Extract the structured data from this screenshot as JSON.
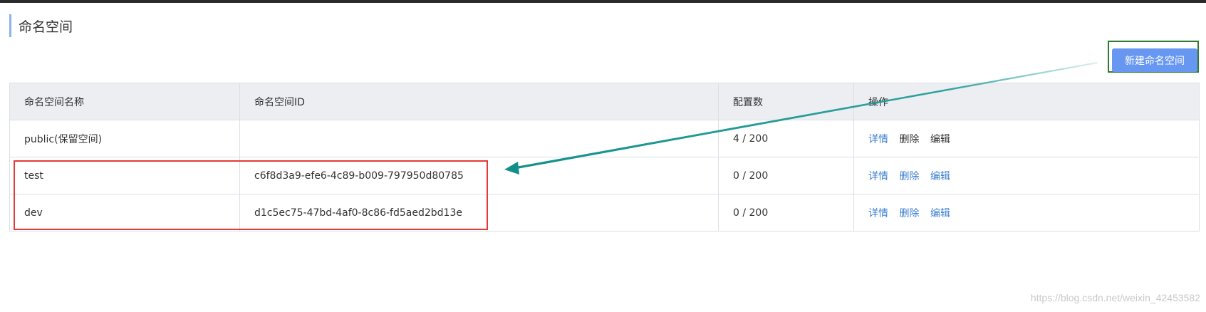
{
  "page": {
    "title": "命名空间"
  },
  "toolbar": {
    "new_namespace_label": "新建命名空间"
  },
  "table": {
    "headers": [
      "命名空间名称",
      "命名空间ID",
      "配置数",
      "操作"
    ],
    "rows": [
      {
        "name": "public(保留空间)",
        "id": "",
        "config_count": "4 / 200",
        "actions": {
          "detail": "详情",
          "delete": "删除",
          "edit": "编辑"
        }
      },
      {
        "name": "test",
        "id": "c6f8d3a9-efe6-4c89-b009-797950d80785",
        "config_count": "0 / 200",
        "actions": {
          "detail": "详情",
          "delete": "删除",
          "edit": "编辑"
        }
      },
      {
        "name": "dev",
        "id": "d1c5ec75-47bd-4af0-8c86-fd5aed2bd13e",
        "config_count": "0 / 200",
        "actions": {
          "detail": "详情",
          "delete": "删除",
          "edit": "编辑"
        }
      }
    ]
  },
  "watermark": "https://blog.csdn.net/weixin_42453582",
  "colors": {
    "primary_button": "#6797f0",
    "link": "#3d7fd0",
    "annotation_red": "#e53935",
    "annotation_green": "#2e7d32",
    "annotation_arrow": "#1a9a96"
  }
}
